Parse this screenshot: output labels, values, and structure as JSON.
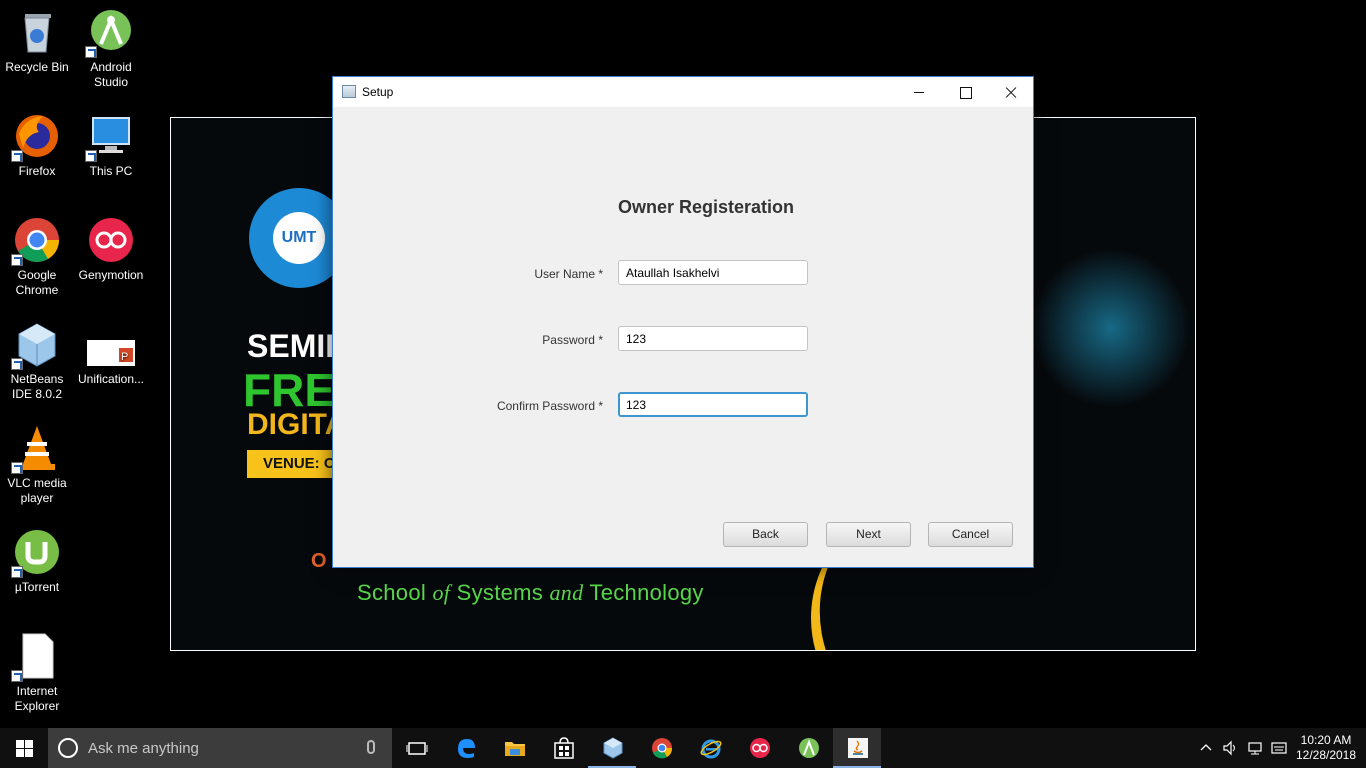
{
  "desktop": {
    "icons": [
      {
        "label": "Recycle Bin"
      },
      {
        "label": "Android Studio"
      },
      {
        "label": "Firefox"
      },
      {
        "label": "This PC"
      },
      {
        "label": "Google Chrome"
      },
      {
        "label": "Genymotion"
      },
      {
        "label": "NetBeans IDE 8.0.2"
      },
      {
        "label": "Unification..."
      },
      {
        "label": "VLC media player"
      },
      {
        "label": "µTorrent"
      },
      {
        "label": "Internet Explorer"
      }
    ]
  },
  "poster": {
    "line1": "SEMII",
    "line2": "FRE",
    "line3": "DIGITA",
    "venue": "VENUE: C",
    "orange": "O",
    "school_part1": "School ",
    "school_of": "of",
    "school_part2": " Systems ",
    "school_and": "and",
    "school_part3": " Technology",
    "seal_text": "UMT"
  },
  "window": {
    "title": "Setup",
    "heading": "Owner Registeration",
    "fields": {
      "username": {
        "label": "User Name *",
        "value": "Ataullah Isakhelvi"
      },
      "password": {
        "label": "Password *",
        "value": "123"
      },
      "confirm": {
        "label": "Confirm Password *",
        "value": "123"
      }
    },
    "buttons": {
      "back": "Back",
      "next": "Next",
      "cancel": "Cancel"
    }
  },
  "taskbar": {
    "search_placeholder": "Ask me anything",
    "time": "10:20 AM",
    "date": "12/28/2018",
    "colors": {
      "accent": "#8ab4e6",
      "bar": "#101010"
    }
  }
}
